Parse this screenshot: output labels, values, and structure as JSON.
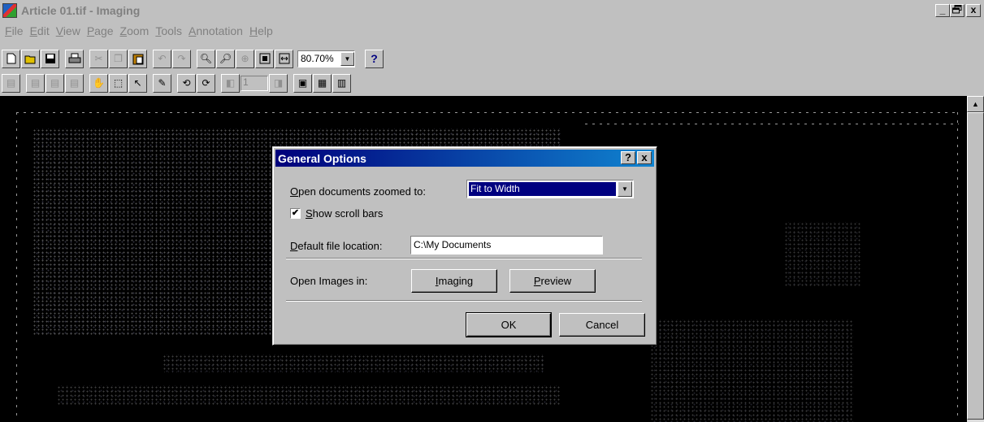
{
  "window": {
    "title": "Article 01.tif - Imaging",
    "buttons": [
      "_",
      " ",
      "x"
    ]
  },
  "menu": [
    {
      "pre": "",
      "u": "F",
      "post": "ile"
    },
    {
      "pre": "",
      "u": "E",
      "post": "dit"
    },
    {
      "pre": "",
      "u": "V",
      "post": "iew"
    },
    {
      "pre": "",
      "u": "P",
      "post": "age"
    },
    {
      "pre": "",
      "u": "Z",
      "post": "oom"
    },
    {
      "pre": "",
      "u": "T",
      "post": "ools"
    },
    {
      "pre": "",
      "u": "A",
      "post": "nnotation"
    },
    {
      "pre": "",
      "u": "H",
      "post": "elp"
    }
  ],
  "toolbar": {
    "zoom_value": "80.70%",
    "help_label": "?",
    "page_number": "1"
  },
  "dialog": {
    "title": "General Options",
    "title_buttons": [
      "?",
      "x"
    ],
    "zoom_label_u": "O",
    "zoom_label_rest": "pen documents zoomed to:",
    "zoom_value": "Fit to Width",
    "scroll_check": "✔",
    "scroll_label_u": "S",
    "scroll_label_rest": "how scroll bars",
    "file_label_u": "D",
    "file_label_rest": "efault file location:",
    "file_value": "C:\\My Documents",
    "open_in_label": "Open Images in:",
    "imaging_u": "I",
    "imaging_rest": "maging",
    "preview_u": "P",
    "preview_rest": "review",
    "ok_label": "OK",
    "cancel_label": "Cancel"
  },
  "scrollbar": {
    "up_arrow": "▲"
  }
}
